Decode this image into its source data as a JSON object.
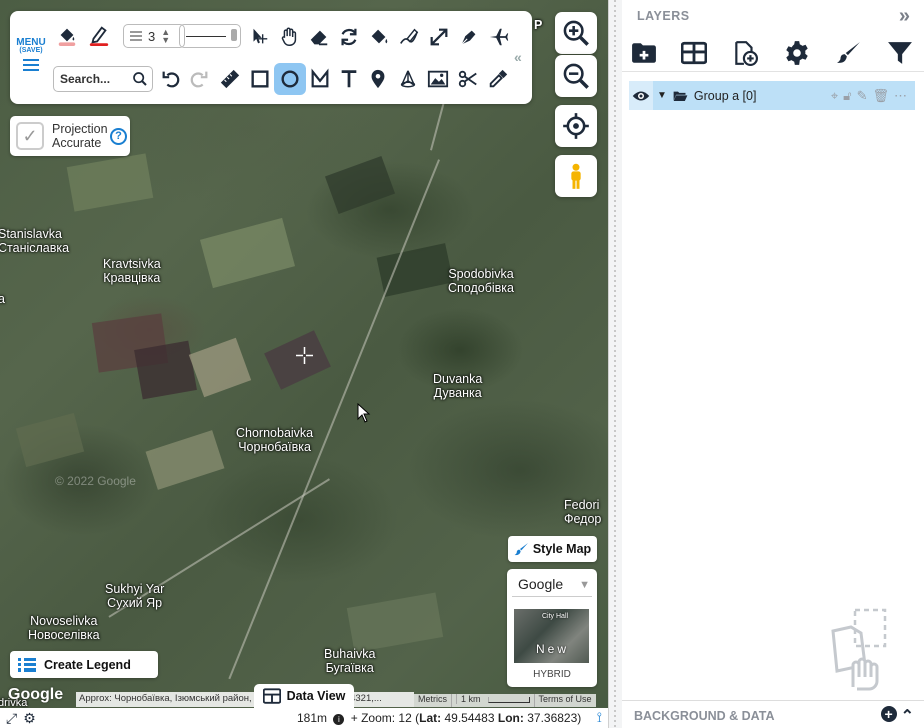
{
  "toolbar": {
    "menu_label": "MENU",
    "menu_sub": "(SAVE)",
    "stroke_width": "3",
    "search_placeholder": "Search..."
  },
  "projection": {
    "line1": "Projection",
    "line2": "Accurate",
    "help": "?",
    "checked": true
  },
  "map": {
    "places": [
      {
        "latin": "Stanislavka",
        "cyr": "Станіславка"
      },
      {
        "latin": "Kravtsivka",
        "cyr": "Кравцівка"
      },
      {
        "latin": "Spodobivka",
        "cyr": "Сподобівка"
      },
      {
        "latin": "Duvanka",
        "cyr": "Дуванка"
      },
      {
        "latin": "Chornobaivka",
        "cyr": "Чорнобаївка"
      },
      {
        "latin": "Fedori",
        "cyr": "Федор"
      },
      {
        "latin": "Sukhyi Yar",
        "cyr": "Сухий Яр"
      },
      {
        "latin": "Novoselivka",
        "cyr": "Новоселівка"
      },
      {
        "latin": "Buhaivka",
        "cyr": "Бугаївка"
      }
    ],
    "fragment_a": "a",
    "fragment_p": "P",
    "fragment_drivka": "drivka",
    "watermark": "© 2022 Google",
    "style_map_label": "Style Map",
    "basemap_value": "Google",
    "basemap_name": "HYBRID",
    "basemap_thumb_text": "New",
    "basemap_thumb_text2": "City Hall",
    "create_legend_label": "Create Legend",
    "data_view_label": "Data View",
    "google_logo": "Google",
    "approx_text": "Approx: Чорнобаївка, Ізюмський район, Харківська область, 64321,...",
    "attribution": {
      "metrics": "Metrics",
      "scale": "1 km",
      "terms": "Terms of Use"
    }
  },
  "status": {
    "scale": "181m",
    "zoom_label": "Zoom: 12",
    "lat_label": "Lat:",
    "lat": "49.54483",
    "lon_label": "Lon:",
    "lon": "37.36823"
  },
  "layers": {
    "title": "LAYERS",
    "items": [
      {
        "name": "Group a [0]",
        "type": "group",
        "visible": true
      }
    ],
    "bg_title": "BACKGROUND & DATA"
  },
  "colors": {
    "accent": "#1a7fd1",
    "layer_row": "#bde0f7",
    "dark_icon": "#1e2a3a",
    "red": "#e02020"
  }
}
